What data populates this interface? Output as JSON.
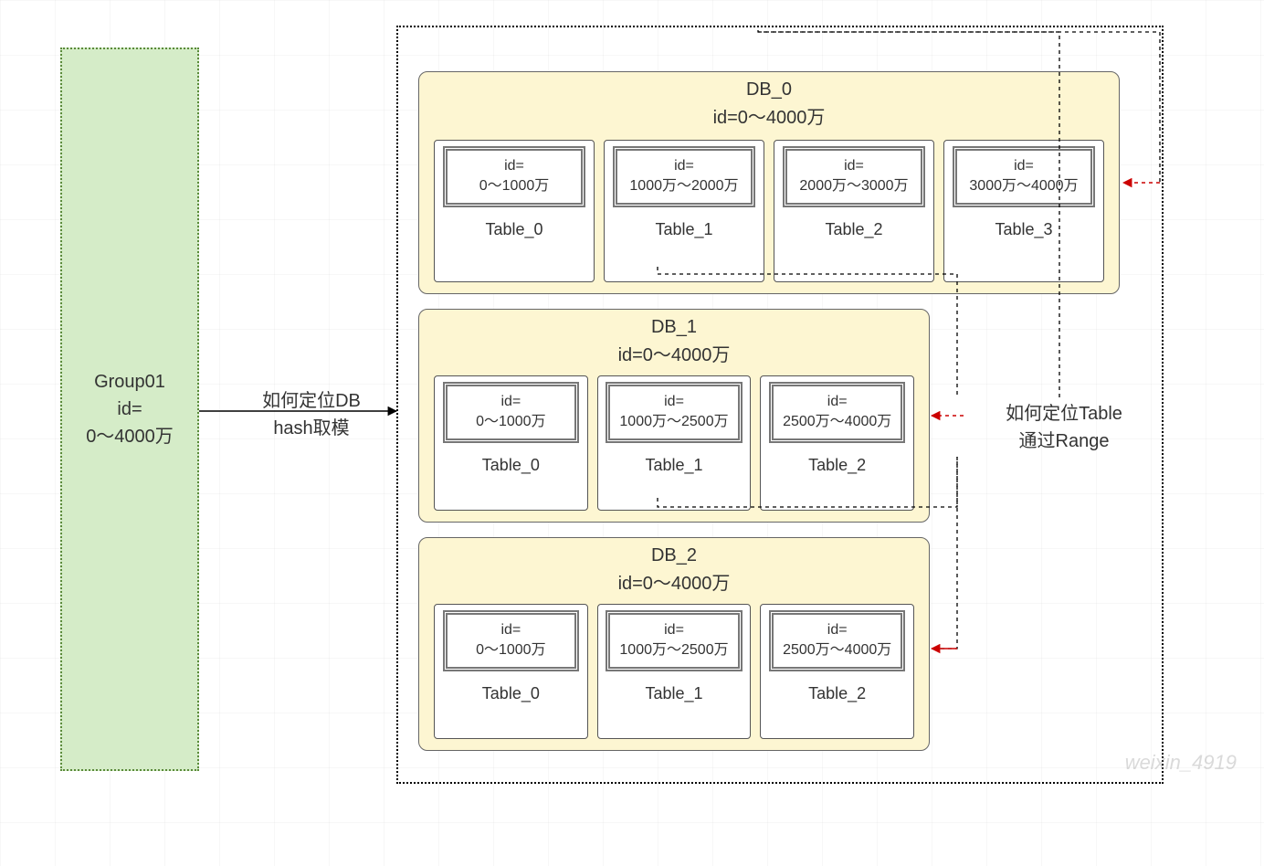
{
  "group": {
    "title": "Group01",
    "id_label": "id=",
    "range": "0～4000万"
  },
  "label_left": {
    "line1": "如何定位DB",
    "line2": "hash取模"
  },
  "label_right": {
    "line1": "如何定位Table",
    "line2": "通过Range"
  },
  "databases": [
    {
      "name": "DB_0",
      "range": "id=0～4000万",
      "tables": [
        {
          "id_line1": "id=",
          "id_line2": "0～1000万",
          "name": "Table_0"
        },
        {
          "id_line1": "id=",
          "id_line2": "1000万～2000万",
          "name": "Table_1"
        },
        {
          "id_line1": "id=",
          "id_line2": "2000万～3000万",
          "name": "Table_2"
        },
        {
          "id_line1": "id=",
          "id_line2": "3000万～4000万",
          "name": "Table_3"
        }
      ]
    },
    {
      "name": "DB_1",
      "range": "id=0～4000万",
      "tables": [
        {
          "id_line1": "id=",
          "id_line2": "0～1000万",
          "name": "Table_0"
        },
        {
          "id_line1": "id=",
          "id_line2": "1000万～2500万",
          "name": "Table_1"
        },
        {
          "id_line1": "id=",
          "id_line2": "2500万～4000万",
          "name": "Table_2"
        }
      ]
    },
    {
      "name": "DB_2",
      "range": "id=0～4000万",
      "tables": [
        {
          "id_line1": "id=",
          "id_line2": "0～1000万",
          "name": "Table_0"
        },
        {
          "id_line1": "id=",
          "id_line2": "1000万～2500万",
          "name": "Table_1"
        },
        {
          "id_line1": "id=",
          "id_line2": "2500万～4000万",
          "name": "Table_2"
        }
      ]
    }
  ],
  "watermark": "weixin_4919"
}
